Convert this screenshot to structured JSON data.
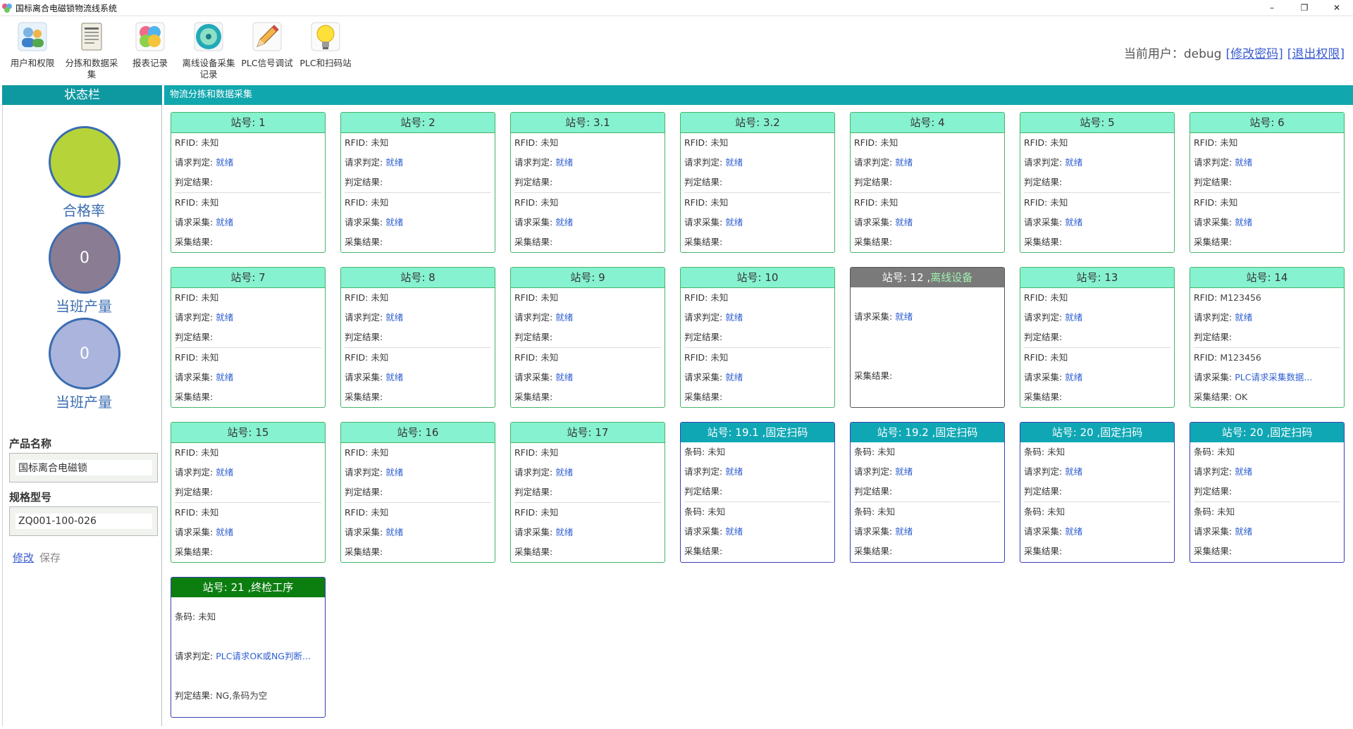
{
  "window": {
    "title": "国标离合电磁锁物流线系统",
    "minimize": "–",
    "maximize": "❐",
    "close": "✕"
  },
  "toolbar": {
    "tools": [
      {
        "label": "用户和权限",
        "icon": "users-icon"
      },
      {
        "label": "分拣和数据采集",
        "icon": "document-icon"
      },
      {
        "label": "报表记录",
        "icon": "report-icon"
      },
      {
        "label": "离线设备采集记录",
        "icon": "disc-icon"
      },
      {
        "label": "PLC信号调试",
        "icon": "pencil-icon"
      },
      {
        "label": "PLC和扫码站",
        "icon": "lightbulb-icon"
      }
    ],
    "user_prefix": "当前用户：debug",
    "change_password": "[修改密码]",
    "logout": "[退出权限]"
  },
  "sidebar": {
    "title": "状态栏",
    "stats": [
      {
        "caption": "合格率",
        "value": "",
        "color": "#b6d43a"
      },
      {
        "caption": "当班产量",
        "value": "0",
        "color": "#8a7d93"
      },
      {
        "caption": "当班产量",
        "value": "0",
        "color": "#aab4dd"
      }
    ],
    "product_name_label": "产品名称",
    "product_name_value": "国标离合电磁锁",
    "spec_label": "规格型号",
    "spec_value": "ZQ001-100-026",
    "edit_link": "修改",
    "save_link": "保存"
  },
  "main": {
    "title": "物流分拣和数据采集",
    "stations": [
      {
        "title": "站号: 1",
        "rows": [
          [
            "RFID: ",
            "未知",
            "p"
          ],
          [
            "请求判定: ",
            "就绪",
            "v"
          ],
          [
            "判定结果: ",
            "",
            "p"
          ],
          [
            "RFID: ",
            "未知",
            "p"
          ],
          [
            "请求采集: ",
            "就绪",
            "v"
          ],
          [
            "采集结果: ",
            "",
            "p"
          ]
        ]
      },
      {
        "title": "站号: 2",
        "rows": [
          [
            "RFID: ",
            "未知",
            "p"
          ],
          [
            "请求判定: ",
            "就绪",
            "v"
          ],
          [
            "判定结果: ",
            "",
            "p"
          ],
          [
            "RFID: ",
            "未知",
            "p"
          ],
          [
            "请求采集: ",
            "就绪",
            "v"
          ],
          [
            "采集结果: ",
            "",
            "p"
          ]
        ]
      },
      {
        "title": "站号: 3.1",
        "rows": [
          [
            "RFID: ",
            "未知",
            "p"
          ],
          [
            "请求判定: ",
            "就绪",
            "v"
          ],
          [
            "判定结果: ",
            "",
            "p"
          ],
          [
            "RFID: ",
            "未知",
            "p"
          ],
          [
            "请求采集: ",
            "就绪",
            "v"
          ],
          [
            "采集结果: ",
            "",
            "p"
          ]
        ]
      },
      {
        "title": "站号: 3.2",
        "rows": [
          [
            "RFID: ",
            "未知",
            "p"
          ],
          [
            "请求判定: ",
            "就绪",
            "v"
          ],
          [
            "判定结果: ",
            "",
            "p"
          ],
          [
            "RFID: ",
            "未知",
            "p"
          ],
          [
            "请求采集: ",
            "就绪",
            "v"
          ],
          [
            "采集结果: ",
            "",
            "p"
          ]
        ]
      },
      {
        "title": "站号: 4",
        "rows": [
          [
            "RFID: ",
            "未知",
            "p"
          ],
          [
            "请求判定: ",
            "就绪",
            "v"
          ],
          [
            "判定结果: ",
            "",
            "p"
          ],
          [
            "RFID: ",
            "未知",
            "p"
          ],
          [
            "请求采集: ",
            "就绪",
            "v"
          ],
          [
            "采集结果: ",
            "",
            "p"
          ]
        ]
      },
      {
        "title": "站号: 5",
        "rows": [
          [
            "RFID: ",
            "未知",
            "p"
          ],
          [
            "请求判定: ",
            "就绪",
            "v"
          ],
          [
            "判定结果: ",
            "",
            "p"
          ],
          [
            "RFID: ",
            "未知",
            "p"
          ],
          [
            "请求采集: ",
            "就绪",
            "v"
          ],
          [
            "采集结果: ",
            "",
            "p"
          ]
        ]
      },
      {
        "title": "站号: 6",
        "rows": [
          [
            "RFID: ",
            "未知",
            "p"
          ],
          [
            "请求判定: ",
            "就绪",
            "v"
          ],
          [
            "判定结果: ",
            "",
            "p"
          ],
          [
            "RFID: ",
            "未知",
            "p"
          ],
          [
            "请求采集: ",
            "就绪",
            "v"
          ],
          [
            "采集结果: ",
            "",
            "p"
          ]
        ]
      },
      {
        "title": "站号: 7",
        "rows": [
          [
            "RFID: ",
            "未知",
            "p"
          ],
          [
            "请求判定: ",
            "就绪",
            "v"
          ],
          [
            "判定结果: ",
            "",
            "p"
          ],
          [
            "RFID: ",
            "未知",
            "p"
          ],
          [
            "请求采集: ",
            "就绪",
            "v"
          ],
          [
            "采集结果: ",
            "",
            "p"
          ]
        ]
      },
      {
        "title": "站号: 8",
        "rows": [
          [
            "RFID: ",
            "未知",
            "p"
          ],
          [
            "请求判定: ",
            "就绪",
            "v"
          ],
          [
            "判定结果: ",
            "",
            "p"
          ],
          [
            "RFID: ",
            "未知",
            "p"
          ],
          [
            "请求采集: ",
            "就绪",
            "v"
          ],
          [
            "采集结果: ",
            "",
            "p"
          ]
        ]
      },
      {
        "title": "站号: 9",
        "rows": [
          [
            "RFID: ",
            "未知",
            "p"
          ],
          [
            "请求判定: ",
            "就绪",
            "v"
          ],
          [
            "判定结果: ",
            "",
            "p"
          ],
          [
            "RFID: ",
            "未知",
            "p"
          ],
          [
            "请求采集: ",
            "就绪",
            "v"
          ],
          [
            "采集结果: ",
            "",
            "p"
          ]
        ]
      },
      {
        "title": "站号: 10",
        "rows": [
          [
            "RFID: ",
            "未知",
            "p"
          ],
          [
            "请求判定: ",
            "就绪",
            "v"
          ],
          [
            "判定结果: ",
            "",
            "p"
          ],
          [
            "RFID: ",
            "未知",
            "p"
          ],
          [
            "请求采集: ",
            "就绪",
            "v"
          ],
          [
            "采集结果: ",
            "",
            "p"
          ]
        ]
      },
      {
        "title": "站号: 12 ,",
        "tag": "离线设备",
        "rows": [
          [
            "请求采集: ",
            "就绪",
            "v"
          ],
          [
            "采集结果: ",
            "",
            "p"
          ]
        ]
      },
      {
        "title": "站号: 13",
        "rows": [
          [
            "RFID: ",
            "未知",
            "p"
          ],
          [
            "请求判定: ",
            "就绪",
            "v"
          ],
          [
            "判定结果: ",
            "",
            "p"
          ],
          [
            "RFID: ",
            "未知",
            "p"
          ],
          [
            "请求采集: ",
            "就绪",
            "v"
          ],
          [
            "采集结果: ",
            "",
            "p"
          ]
        ]
      },
      {
        "title": "站号: 14",
        "rows": [
          [
            "RFID: ",
            "M123456",
            "p"
          ],
          [
            "请求判定: ",
            "就绪",
            "v"
          ],
          [
            "判定结果: ",
            "",
            "p"
          ],
          [
            "RFID: ",
            "M123456",
            "p"
          ],
          [
            "请求采集: ",
            "PLC请求采集数据...",
            "v"
          ],
          [
            "采集结果: ",
            "OK",
            "p"
          ]
        ]
      },
      {
        "title": "站号: 15",
        "rows": [
          [
            "RFID: ",
            "未知",
            "p"
          ],
          [
            "请求判定: ",
            "就绪",
            "v"
          ],
          [
            "判定结果: ",
            "",
            "p"
          ],
          [
            "RFID: ",
            "未知",
            "p"
          ],
          [
            "请求采集: ",
            "就绪",
            "v"
          ],
          [
            "采集结果: ",
            "",
            "p"
          ]
        ]
      },
      {
        "title": "站号: 16",
        "rows": [
          [
            "RFID: ",
            "未知",
            "p"
          ],
          [
            "请求判定: ",
            "就绪",
            "v"
          ],
          [
            "判定结果: ",
            "",
            "p"
          ],
          [
            "RFID: ",
            "未知",
            "p"
          ],
          [
            "请求采集: ",
            "就绪",
            "v"
          ],
          [
            "采集结果: ",
            "",
            "p"
          ]
        ]
      },
      {
        "title": "站号: 17",
        "rows": [
          [
            "RFID: ",
            "未知",
            "p"
          ],
          [
            "请求判定: ",
            "就绪",
            "v"
          ],
          [
            "判定结果: ",
            "",
            "p"
          ],
          [
            "RFID: ",
            "未知",
            "p"
          ],
          [
            "请求采集: ",
            "就绪",
            "v"
          ],
          [
            "采集结果: ",
            "",
            "p"
          ]
        ]
      },
      {
        "title": "站号: 19.1 ,固定扫码",
        "rows": [
          [
            "条码: ",
            "未知",
            "p"
          ],
          [
            "请求判定: ",
            "就绪",
            "v"
          ],
          [
            "判定结果: ",
            "",
            "p"
          ],
          [
            "条码: ",
            "未知",
            "p"
          ],
          [
            "请求采集: ",
            "就绪",
            "v"
          ],
          [
            "采集结果: ",
            "",
            "p"
          ]
        ]
      },
      {
        "title": "站号: 19.2 ,固定扫码",
        "rows": [
          [
            "条码: ",
            "未知",
            "p"
          ],
          [
            "请求判定: ",
            "就绪",
            "v"
          ],
          [
            "判定结果: ",
            "",
            "p"
          ],
          [
            "条码: ",
            "未知",
            "p"
          ],
          [
            "请求采集: ",
            "就绪",
            "v"
          ],
          [
            "采集结果: ",
            "",
            "p"
          ]
        ]
      },
      {
        "title": "站号: 20 ,固定扫码",
        "rows": [
          [
            "条码: ",
            "未知",
            "p"
          ],
          [
            "请求判定: ",
            "就绪",
            "v"
          ],
          [
            "判定结果: ",
            "",
            "p"
          ],
          [
            "条码: ",
            "未知",
            "p"
          ],
          [
            "请求采集: ",
            "就绪",
            "v"
          ],
          [
            "采集结果: ",
            "",
            "p"
          ]
        ]
      },
      {
        "title": "站号: 20 ,固定扫码",
        "rows": [
          [
            "条码: ",
            "未知",
            "p"
          ],
          [
            "请求判定: ",
            "就绪",
            "v"
          ],
          [
            "判定结果: ",
            "",
            "p"
          ],
          [
            "条码: ",
            "未知",
            "p"
          ],
          [
            "请求采集: ",
            "就绪",
            "v"
          ],
          [
            "采集结果: ",
            "",
            "p"
          ]
        ]
      },
      {
        "title": "站号: 21 ,终检工序",
        "rows": [
          [
            "条码: ",
            "未知",
            "p"
          ],
          [
            "请求判定: ",
            "PLC请求OK或NG判断...",
            "v"
          ],
          [
            "判定结果: ",
            "NG,条码为空",
            "p"
          ]
        ]
      }
    ]
  }
}
